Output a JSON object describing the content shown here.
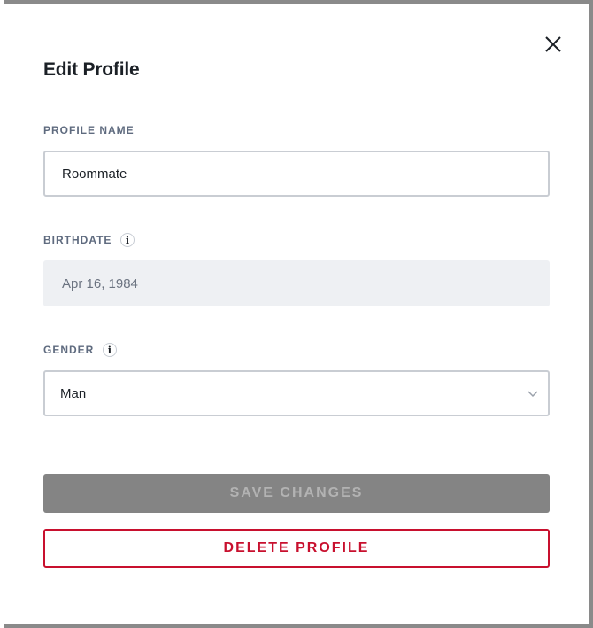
{
  "modal": {
    "title": "Edit Profile",
    "close_icon": "close-icon"
  },
  "fields": {
    "profile_name": {
      "label": "PROFILE NAME",
      "value": "Roommate"
    },
    "birthdate": {
      "label": "BIRTHDATE",
      "info_icon": "info-icon",
      "value": "Apr 16, 1984"
    },
    "gender": {
      "label": "GENDER",
      "info_icon": "info-icon",
      "value": "Man",
      "chevron_icon": "chevron-down-icon"
    }
  },
  "actions": {
    "save_label": "SAVE CHANGES",
    "delete_label": "DELETE PROFILE"
  },
  "colors": {
    "overlay": "#8a8a8a",
    "danger": "#c8102e",
    "disabled_button": "#848484"
  }
}
